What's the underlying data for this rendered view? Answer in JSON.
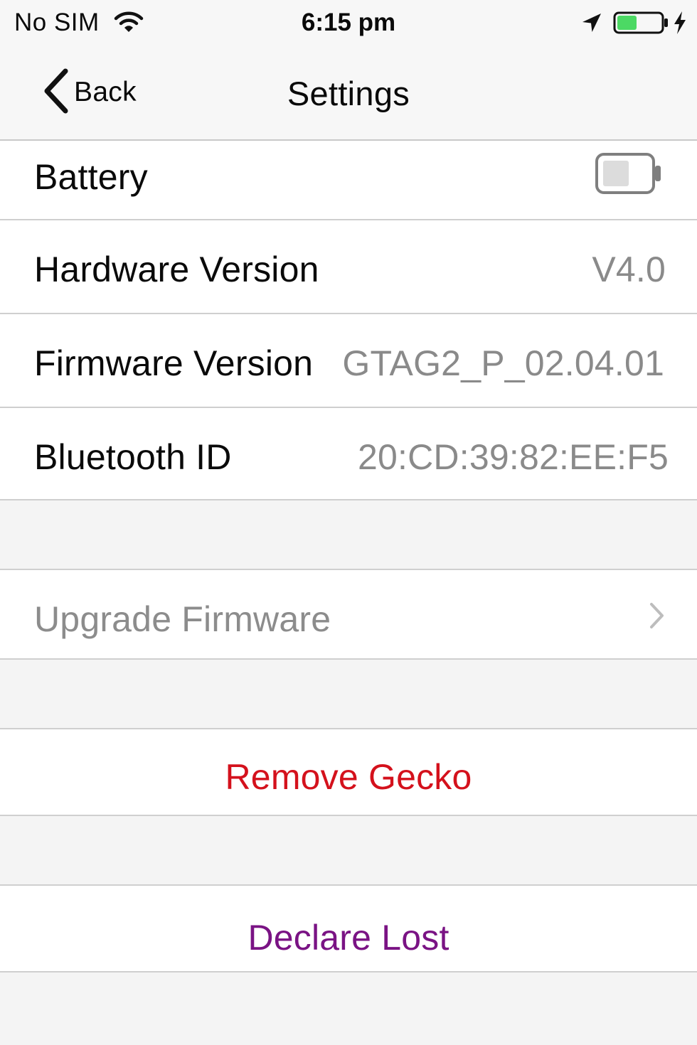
{
  "status_bar": {
    "carrier": "No SIM",
    "time": "6:15 pm",
    "battery_level": 0.45,
    "battery_color": "#4cd964"
  },
  "nav": {
    "back_label": "Back",
    "title": "Settings"
  },
  "info_rows": {
    "battery": {
      "label": "Battery",
      "icon": "battery-icon"
    },
    "hardware": {
      "label": "Hardware Version",
      "value": "V4.0"
    },
    "firmware": {
      "label": "Firmware Version",
      "value": "GTAG2_P_02.04.01"
    },
    "bluetooth": {
      "label": "Bluetooth ID",
      "value": "20:CD:39:82:EE:F5"
    }
  },
  "upgrade": {
    "label": "Upgrade Firmware",
    "icon": "chevron-right-icon"
  },
  "actions": {
    "remove": {
      "label": "Remove Gecko",
      "color": "#d4111c"
    },
    "declare": {
      "label": "Declare Lost",
      "color": "#7a1384"
    }
  }
}
